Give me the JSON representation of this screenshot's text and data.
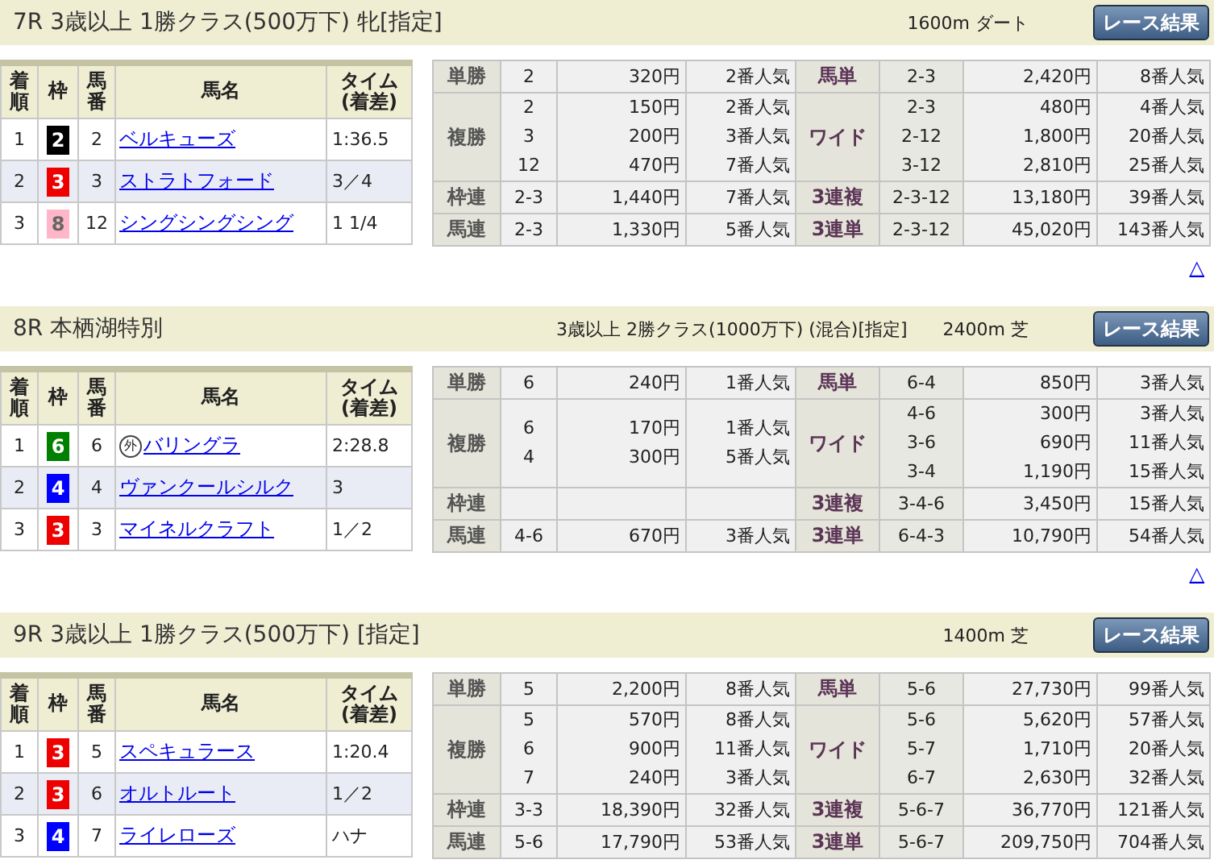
{
  "races": [
    {
      "title": "7R 3歳以上 1勝クラス(500万下) 牝[指定]",
      "course": "1600m ダート",
      "button": "レース結果",
      "columns": [
        "着順",
        "枠",
        "馬番",
        "馬名",
        "タイム(着差)"
      ],
      "results": [
        {
          "place": "1",
          "frame": "2",
          "color": "#000000",
          "number": "2",
          "name": "ベルキューズ",
          "time": "1:36.5"
        },
        {
          "place": "2",
          "frame": "3",
          "color": "#ee0000",
          "number": "3",
          "name": "ストラトフォード",
          "time": "3／4"
        },
        {
          "place": "3",
          "frame": "8",
          "color": "#ffb6c8",
          "number": "12",
          "name": "シングシングシング",
          "time": "1 1/4"
        }
      ],
      "payouts": [
        {
          "left": {
            "label": "単勝",
            "lines": [
              {
                "combo": "2",
                "payout": "320円",
                "popularity": "2番人気"
              }
            ]
          },
          "right": {
            "label": "馬単",
            "lines": [
              {
                "combo": "2-3",
                "payout": "2,420円",
                "popularity": "8番人気"
              }
            ]
          }
        },
        {
          "left": {
            "label": "複勝",
            "lines": [
              {
                "combo": "2",
                "payout": "150円",
                "popularity": "2番人気"
              },
              {
                "combo": "3",
                "payout": "200円",
                "popularity": "3番人気"
              },
              {
                "combo": "12",
                "payout": "470円",
                "popularity": "7番人気"
              }
            ]
          },
          "right": {
            "label": "ワイド",
            "lines": [
              {
                "combo": "2-3",
                "payout": "480円",
                "popularity": "4番人気"
              },
              {
                "combo": "2-12",
                "payout": "1,800円",
                "popularity": "20番人気"
              },
              {
                "combo": "3-12",
                "payout": "2,810円",
                "popularity": "25番人気"
              }
            ]
          }
        },
        {
          "left": {
            "label": "枠連",
            "lines": [
              {
                "combo": "2-3",
                "payout": "1,440円",
                "popularity": "7番人気"
              }
            ]
          },
          "right": {
            "label": "3連複",
            "lines": [
              {
                "combo": "2-3-12",
                "payout": "13,180円",
                "popularity": "39番人気"
              }
            ]
          }
        },
        {
          "left": {
            "label": "馬連",
            "lines": [
              {
                "combo": "2-3",
                "payout": "1,330円",
                "popularity": "5番人気"
              }
            ]
          },
          "right": {
            "label": "3連単",
            "lines": [
              {
                "combo": "2-3-12",
                "payout": "45,020円",
                "popularity": "143番人気"
              }
            ]
          }
        }
      ],
      "top_link": "△"
    },
    {
      "title": "8R 本栖湖特別",
      "conditions": "3歳以上 2勝クラス(1000万下) (混合)[指定]",
      "course": "2400m 芝",
      "button": "レース結果",
      "columns": [
        "着順",
        "枠",
        "馬番",
        "馬名",
        "タイム(着差)"
      ],
      "results": [
        {
          "place": "1",
          "frame": "6",
          "color": "#008000",
          "number": "6",
          "mark": "外",
          "name": "バリングラ",
          "time": "2:28.8"
        },
        {
          "place": "2",
          "frame": "4",
          "color": "#0000ff",
          "number": "4",
          "name": "ヴァンクールシルク",
          "time": "3"
        },
        {
          "place": "3",
          "frame": "3",
          "color": "#ee0000",
          "number": "3",
          "name": "マイネルクラフト",
          "time": "1／2"
        }
      ],
      "payouts": [
        {
          "left": {
            "label": "単勝",
            "lines": [
              {
                "combo": "6",
                "payout": "240円",
                "popularity": "1番人気"
              }
            ]
          },
          "right": {
            "label": "馬単",
            "lines": [
              {
                "combo": "6-4",
                "payout": "850円",
                "popularity": "3番人気"
              }
            ]
          }
        },
        {
          "left": {
            "label": "複勝",
            "lines": [
              {
                "combo": "6",
                "payout": "170円",
                "popularity": "1番人気"
              },
              {
                "combo": "4",
                "payout": "300円",
                "popularity": "5番人気"
              }
            ]
          },
          "right": {
            "label": "ワイド",
            "lines": [
              {
                "combo": "4-6",
                "payout": "300円",
                "popularity": "3番人気"
              },
              {
                "combo": "3-6",
                "payout": "690円",
                "popularity": "11番人気"
              },
              {
                "combo": "3-4",
                "payout": "1,190円",
                "popularity": "15番人気"
              }
            ]
          }
        },
        {
          "left": {
            "label": "枠連"
          },
          "right": {
            "label": "3連複",
            "lines": [
              {
                "combo": "3-4-6",
                "payout": "3,450円",
                "popularity": "15番人気"
              }
            ]
          }
        },
        {
          "left": {
            "label": "馬連",
            "lines": [
              {
                "combo": "4-6",
                "payout": "670円",
                "popularity": "3番人気"
              }
            ]
          },
          "right": {
            "label": "3連単",
            "lines": [
              {
                "combo": "6-4-3",
                "payout": "10,790円",
                "popularity": "54番人気"
              }
            ]
          }
        }
      ],
      "top_link": "△"
    },
    {
      "title": "9R 3歳以上 1勝クラス(500万下) [指定]",
      "course": "1400m 芝",
      "button": "レース結果",
      "columns": [
        "着順",
        "枠",
        "馬番",
        "馬名",
        "タイム(着差)"
      ],
      "results": [
        {
          "place": "1",
          "frame": "3",
          "color": "#ee0000",
          "number": "5",
          "name": "スペキュラース",
          "time": "1:20.4"
        },
        {
          "place": "2",
          "frame": "3",
          "color": "#ee0000",
          "number": "6",
          "name": "オルトルート",
          "time": "1／2"
        },
        {
          "place": "3",
          "frame": "4",
          "color": "#0000ff",
          "number": "7",
          "name": "ライレローズ",
          "time": "ハナ"
        }
      ],
      "payouts": [
        {
          "left": {
            "label": "単勝",
            "lines": [
              {
                "combo": "5",
                "payout": "2,200円",
                "popularity": "8番人気"
              }
            ]
          },
          "right": {
            "label": "馬単",
            "lines": [
              {
                "combo": "5-6",
                "payout": "27,730円",
                "popularity": "99番人気"
              }
            ]
          }
        },
        {
          "left": {
            "label": "複勝",
            "lines": [
              {
                "combo": "5",
                "payout": "570円",
                "popularity": "8番人気"
              },
              {
                "combo": "6",
                "payout": "900円",
                "popularity": "11番人気"
              },
              {
                "combo": "7",
                "payout": "240円",
                "popularity": "3番人気"
              }
            ]
          },
          "right": {
            "label": "ワイド",
            "lines": [
              {
                "combo": "5-6",
                "payout": "5,620円",
                "popularity": "57番人気"
              },
              {
                "combo": "5-7",
                "payout": "1,710円",
                "popularity": "20番人気"
              },
              {
                "combo": "6-7",
                "payout": "2,630円",
                "popularity": "32番人気"
              }
            ]
          }
        },
        {
          "left": {
            "label": "枠連",
            "lines": [
              {
                "combo": "3-3",
                "payout": "18,390円",
                "popularity": "32番人気"
              }
            ]
          },
          "right": {
            "label": "3連複",
            "lines": [
              {
                "combo": "5-6-7",
                "payout": "36,770円",
                "popularity": "121番人気"
              }
            ]
          }
        },
        {
          "left": {
            "label": "馬連",
            "lines": [
              {
                "combo": "5-6",
                "payout": "17,790円",
                "popularity": "53番人気"
              }
            ]
          },
          "right": {
            "label": "3連単",
            "lines": [
              {
                "combo": "5-6-7",
                "payout": "209,750円",
                "popularity": "704番人気"
              }
            ]
          }
        }
      ]
    }
  ]
}
